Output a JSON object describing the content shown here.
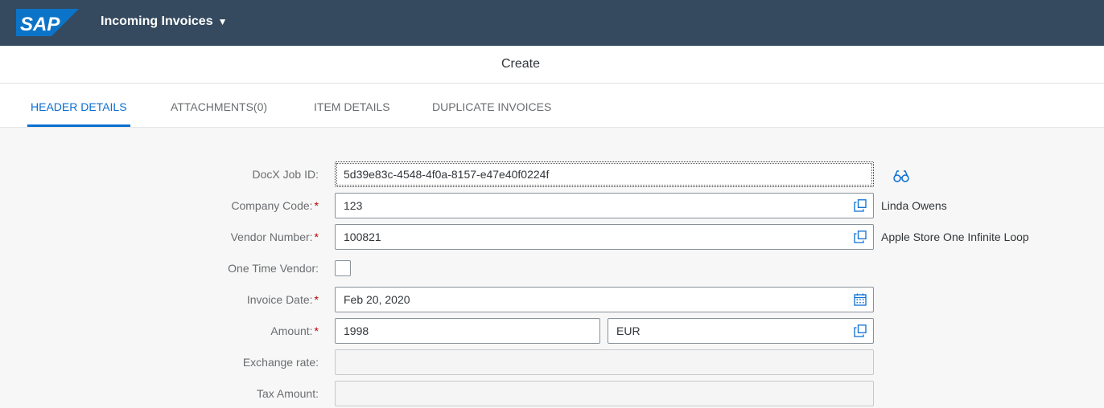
{
  "shell": {
    "logo_text": "SAP",
    "app_title": "Incoming Invoices",
    "colors": {
      "shell_bg": "#354a5f",
      "logo_blue": "#0b74c8",
      "accent": "#0a6ed1",
      "required": "#bb0000"
    }
  },
  "page": {
    "title": "Create"
  },
  "tabs": [
    {
      "label": "HEADER DETAILS",
      "active": true
    },
    {
      "label": "ATTACHMENTS(0)",
      "active": false
    },
    {
      "label": "ITEM DETAILS",
      "active": false
    },
    {
      "label": "DUPLICATE INVOICES",
      "active": false
    }
  ],
  "form": {
    "docx_job_id": {
      "label": "DocX Job ID:",
      "value": "5d39e83c-4548-4f0a-8157-e47e40f0224f",
      "icon": "glasses-icon"
    },
    "company_code": {
      "label": "Company Code:",
      "required_mark": "*",
      "value": "123",
      "description": "Linda Owens",
      "icon": "value-help-icon"
    },
    "vendor_number": {
      "label": "Vendor Number:",
      "required_mark": "*",
      "value": "100821",
      "description": "Apple Store One Infinite Loop",
      "icon": "value-help-icon"
    },
    "one_time_vendor": {
      "label": "One Time Vendor:",
      "checked": false
    },
    "invoice_date": {
      "label": "Invoice Date:",
      "required_mark": "*",
      "value": "Feb 20, 2020",
      "icon": "calendar-icon"
    },
    "amount": {
      "label": "Amount:",
      "required_mark": "*",
      "value": "1998",
      "currency": "EUR",
      "icon": "value-help-icon"
    },
    "exchange_rate": {
      "label": "Exchange rate:",
      "value": ""
    },
    "tax_amount": {
      "label": "Tax Amount:",
      "value": ""
    }
  }
}
